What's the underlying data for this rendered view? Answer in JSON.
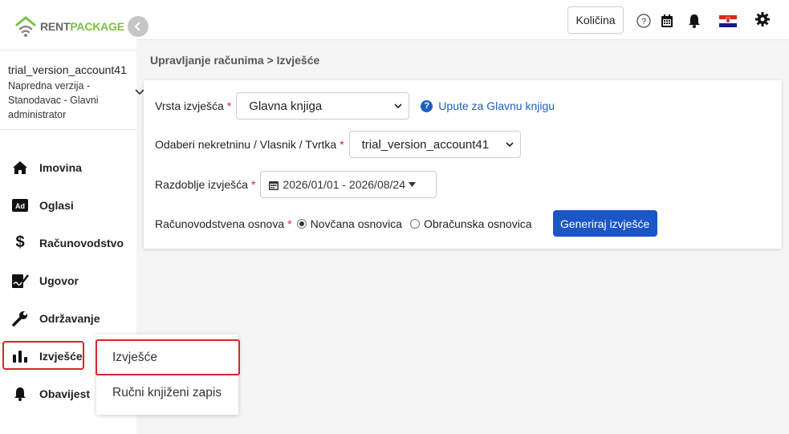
{
  "brand": {
    "part1": "RENT",
    "part2": "PACKAGE"
  },
  "account": {
    "name": "trial_version_account41",
    "description": "Napredna verzija - Stanodavac - Glavni administrator"
  },
  "sidebar": {
    "items": [
      {
        "label": "Imovina",
        "icon": "home-icon"
      },
      {
        "label": "Oglasi",
        "icon": "ad-icon"
      },
      {
        "label": "Računovodstvo",
        "icon": "dollar-icon"
      },
      {
        "label": "Ugovor",
        "icon": "signature-icon"
      },
      {
        "label": "Održavanje",
        "icon": "wrench-icon"
      },
      {
        "label": "Izvješće",
        "icon": "bar-chart-icon"
      },
      {
        "label": "Obavijest",
        "icon": "bell-icon"
      }
    ]
  },
  "submenu": {
    "items": [
      {
        "label": "Izvješće"
      },
      {
        "label": "Ručni knjiženi zapis"
      }
    ]
  },
  "topbar": {
    "quantity_button": "Količina",
    "icons": [
      "help-icon",
      "calendar-icon",
      "bell-icon",
      "croatian-flag-icon",
      "gear-icon"
    ]
  },
  "breadcrumb": "Upravljanje računima > Izvješće",
  "form": {
    "report_type_label": "Vrsta izvješća",
    "report_type_value": "Glavna knjiga",
    "help_link": "Upute za Glavnu knjigu",
    "property_label": "Odaberi nekretninu / Vlasnik / Tvrtka",
    "property_value": "trial_version_account41",
    "period_label": "Razdoblje izvješća",
    "period_value": "2026/01/01 - 2026/08/24",
    "basis_label": "Računovodstvena osnova",
    "basis_options": [
      "Novčana osnovica",
      "Obračunska osnovica"
    ],
    "basis_selected": "Novčana osnovica",
    "generate_button": "Generiraj izvješće",
    "required_mark": "*"
  },
  "colors": {
    "accent": "#1a56c7",
    "brand_green": "#7cc243",
    "highlight_red": "#d9232a"
  }
}
